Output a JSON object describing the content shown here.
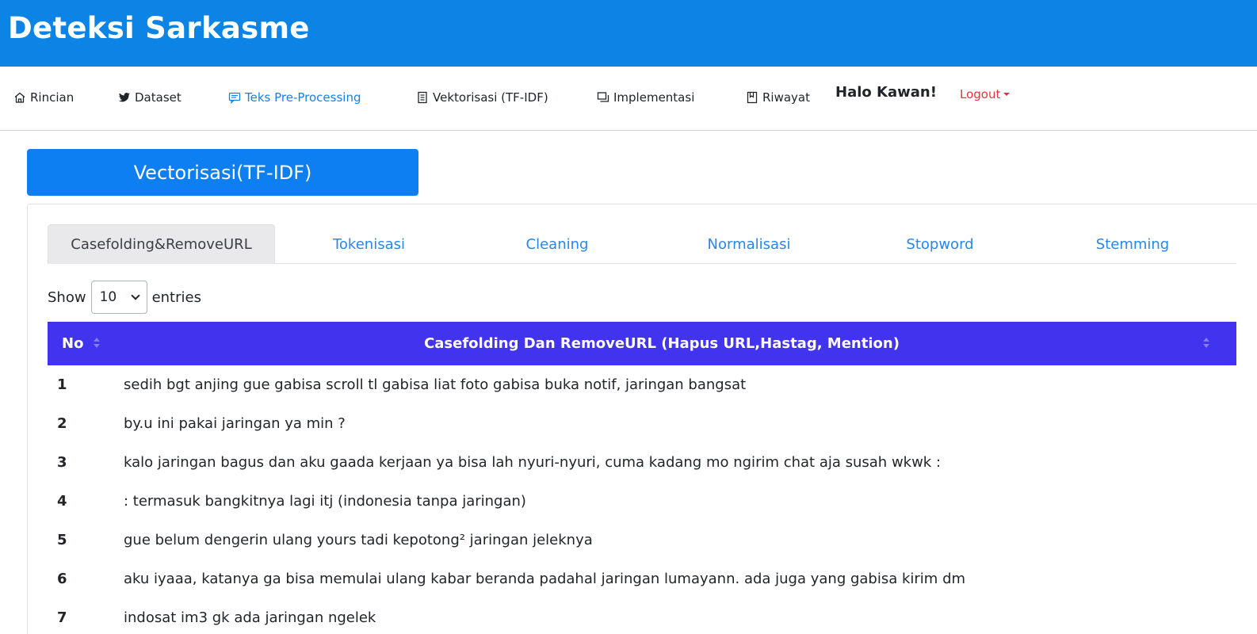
{
  "brand": "Deteksi Sarkasme",
  "nav": {
    "items": [
      {
        "label": "Rincian",
        "icon": "home-icon"
      },
      {
        "label": "Dataset",
        "icon": "twitter-icon"
      },
      {
        "label": "Teks Pre-Processing",
        "icon": "message-icon",
        "active": true
      },
      {
        "label": "Vektorisasi (TF-IDF)",
        "icon": "document-icon"
      },
      {
        "label": "Implementasi",
        "icon": "copy-icon"
      },
      {
        "label": "Riwayat",
        "icon": "bookmark-icon"
      }
    ],
    "greeting": "Halo Kawan!",
    "logout_label": "Logout"
  },
  "section_button": "Vectorisasi(TF-IDF)",
  "tabs": [
    {
      "label": "Casefolding&RemoveURL",
      "active": true
    },
    {
      "label": "Tokenisasi"
    },
    {
      "label": "Cleaning"
    },
    {
      "label": "Normalisasi"
    },
    {
      "label": "Stopword"
    },
    {
      "label": "Stemming"
    }
  ],
  "entries": {
    "show_label": "Show",
    "selected": "10",
    "entries_label": "entries"
  },
  "table": {
    "columns": [
      "No",
      "Casefolding Dan RemoveURL (Hapus URL,Hastag, Mention)"
    ],
    "rows": [
      {
        "no": "1",
        "text": "sedih bgt anjing gue gabisa scroll tl gabisa liat foto gabisa buka notif, jaringan bangsat"
      },
      {
        "no": "2",
        "text": "by.u ini pakai jaringan ya min ?"
      },
      {
        "no": "3",
        "text": "kalo jaringan bagus dan aku gaada kerjaan ya bisa lah nyuri-nyuri, cuma kadang mo ngirim chat aja susah wkwk :"
      },
      {
        "no": "4",
        "text": ": termasuk bangkitnya lagi itj (indonesia tanpa jaringan)"
      },
      {
        "no": "5",
        "text": "gue belum dengerin ulang yours tadi kepotong² jaringan jeleknya"
      },
      {
        "no": "6",
        "text": "aku iyaaa, katanya ga bisa memulai ulang kabar beranda padahal jaringan lumayann. ada juga yang gabisa kirim dm"
      },
      {
        "no": "7",
        "text": "indosat im3 gk ada jaringan ngelek"
      }
    ]
  },
  "colors": {
    "brand_bar": "#0b84e6",
    "section_button": "#0d7ff0",
    "table_header": "#4233ef",
    "tab_link": "#2a86e8",
    "logout": "#e0353b"
  }
}
